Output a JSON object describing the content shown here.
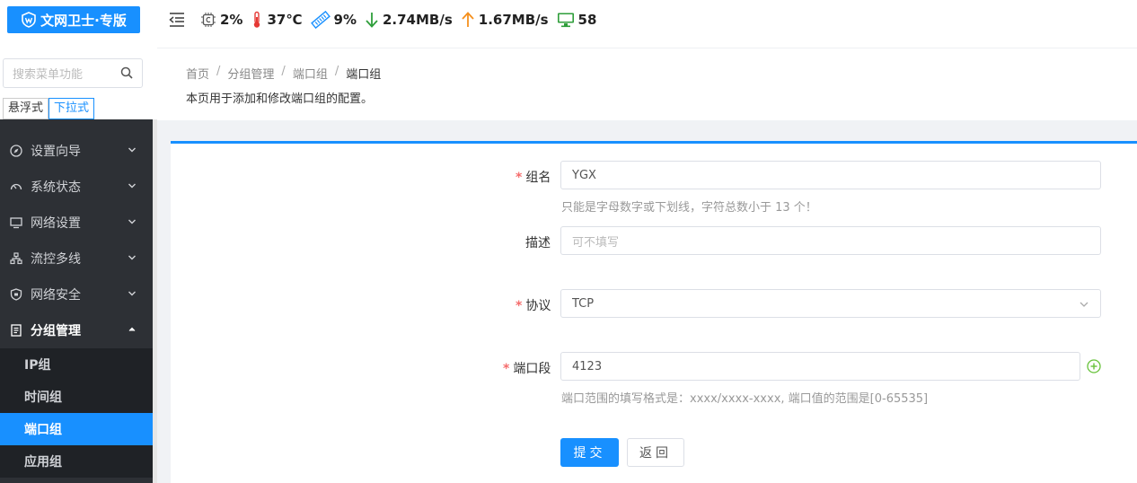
{
  "sidebar": {
    "logo": "文网卫士·专版",
    "search_placeholder": "搜索菜单功能",
    "modes": [
      "悬浮式",
      "下拉式"
    ],
    "menu": [
      {
        "label": "设置向导",
        "icon": "compass-icon"
      },
      {
        "label": "系统状态",
        "icon": "dashboard-icon"
      },
      {
        "label": "网络设置",
        "icon": "monitor-icon"
      },
      {
        "label": "流控多线",
        "icon": "network-icon"
      },
      {
        "label": "网络安全",
        "icon": "shield-icon"
      },
      {
        "label": "分组管理",
        "icon": "document-icon"
      }
    ],
    "submenu": [
      "IP组",
      "时间组",
      "端口组",
      "应用组"
    ]
  },
  "header": {
    "cpu": "2%",
    "temp": "37℃",
    "mem": "9%",
    "download": "2.74MB/s",
    "upload": "1.67MB/s",
    "online": "58"
  },
  "breadcrumb": [
    "首页",
    "分组管理",
    "端口组",
    "端口组"
  ],
  "page_desc": "本页用于添加和修改端口组的配置。",
  "form": {
    "name_label": "组名",
    "name_value": "YGX",
    "name_hint": "只能是字母数字或下划线，字符总数小于 13 个！",
    "desc_label": "描述",
    "desc_placeholder": "可不填写",
    "proto_label": "协议",
    "proto_value": "TCP",
    "port_label": "端口段",
    "port_value": "4123",
    "port_hint": "端口范围的填写格式是：xxxx/xxxx-xxxx, 端口值的范围是[0-65535]",
    "submit": "提交",
    "back": "返回"
  },
  "colors": {
    "accent": "#1890ff",
    "sidebar": "#2d3035",
    "required": "#f56c6c",
    "add": "#67c23a"
  }
}
